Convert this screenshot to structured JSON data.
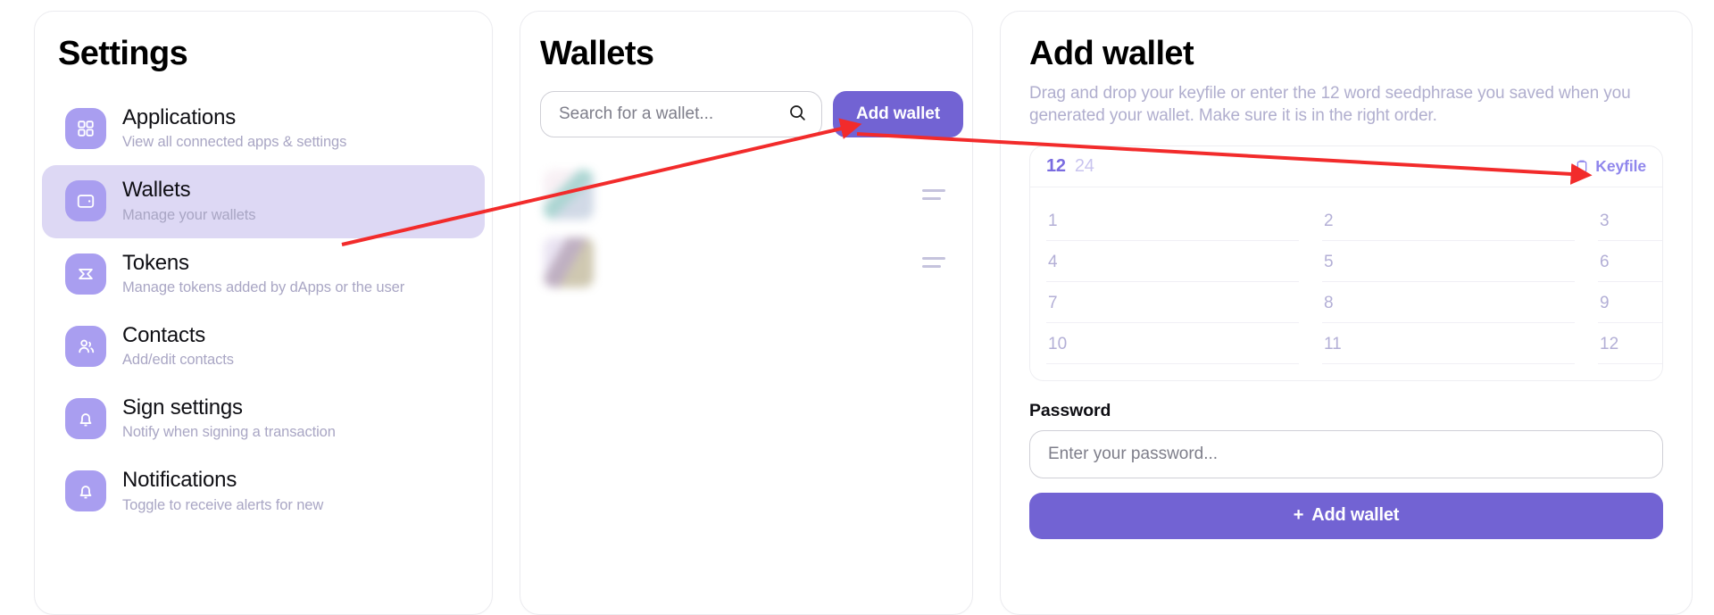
{
  "sidebar": {
    "title": "Settings",
    "items": [
      {
        "label": "Applications",
        "desc": "View all connected apps & settings",
        "icon": "grid-icon",
        "active": false
      },
      {
        "label": "Wallets",
        "desc": "Manage your wallets",
        "icon": "wallet-icon",
        "active": true
      },
      {
        "label": "Tokens",
        "desc": "Manage tokens added by dApps or the user",
        "icon": "token-icon",
        "active": false
      },
      {
        "label": "Contacts",
        "desc": "Add/edit contacts",
        "icon": "contacts-icon",
        "active": false
      },
      {
        "label": "Sign settings",
        "desc": "Notify when signing a transaction",
        "icon": "bell-icon",
        "active": false
      },
      {
        "label": "Notifications",
        "desc": "Toggle to receive alerts for new",
        "icon": "bell-icon",
        "active": false
      }
    ]
  },
  "wallets": {
    "title": "Wallets",
    "search_placeholder": "Search for a wallet...",
    "search_value": "",
    "search_icon": "search-icon",
    "add_button_label": "Add wallet",
    "rows": [
      {
        "name_redacted": true,
        "handle_icon": "drag-handle-icon"
      },
      {
        "name_redacted": true,
        "handle_icon": "drag-handle-icon"
      }
    ]
  },
  "add_wallet": {
    "title": "Add wallet",
    "description": "Drag and drop your keyfile or enter the 12 word seedphrase you saved when you generated your wallet. Make sure it is in the right order.",
    "word_count_options": [
      "12",
      "24"
    ],
    "word_count_selected": "12",
    "keyfile_label": "Keyfile",
    "keyfile_icon": "clipboard-icon",
    "seed_numbers": [
      "1",
      "2",
      "3",
      "4",
      "5",
      "6",
      "7",
      "8",
      "9",
      "10",
      "11",
      "12"
    ],
    "seed_values": [
      "",
      "",
      "",
      "",
      "",
      "",
      "",
      "",
      "",
      "",
      "",
      ""
    ],
    "password_label": "Password",
    "password_placeholder": "Enter your password...",
    "password_value": "",
    "submit_label": "Add wallet",
    "submit_prefix": "+"
  },
  "colors": {
    "accent": "#7263d3",
    "accent_light": "#a99ef0",
    "active_row": "#ddd8f4",
    "muted_text": "#a9a6c4",
    "annotation": "#f22b2b"
  }
}
